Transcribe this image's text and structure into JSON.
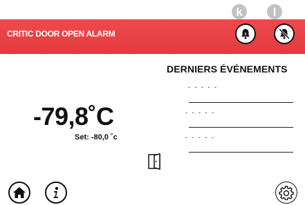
{
  "badges": {
    "left": "k",
    "right": "l"
  },
  "alarm": {
    "title": "CRITIC DOOR OPEN ALARM"
  },
  "buttons": {
    "snooze_icon": "snooze-bell-icon",
    "silence_icon": "silence-bell-icon",
    "home_icon": "home-icon",
    "info_icon": "info-icon",
    "settings_icon": "gear-icon"
  },
  "temperature": {
    "value": "-79,8˚C",
    "setpoint": "Set: -80,0 ˚c"
  },
  "events": {
    "title": "DERNIERS ÉVÉNEMENTS",
    "items": [
      "- - - - -",
      "- - - - -",
      "- - - - -"
    ]
  },
  "door": {
    "icon": "door-open-icon"
  },
  "colors": {
    "alarm_bar": "#e8414a",
    "badge": "#c2c2c2"
  }
}
